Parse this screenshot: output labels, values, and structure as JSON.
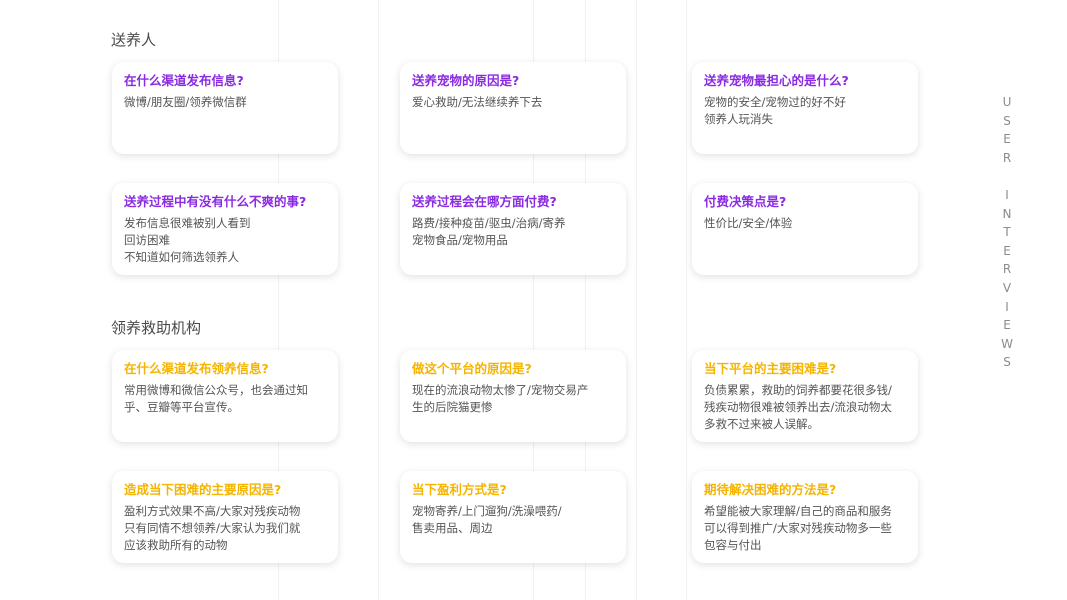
{
  "colors": {
    "purple_question": "#8a2be2",
    "yellow_question": "#f5b400",
    "side_text": "#8c8c8c"
  },
  "side_label": [
    "U",
    "S",
    "E",
    "R",
    "",
    "I",
    "N",
    "T",
    "E",
    "R",
    "V",
    "I",
    "E",
    "W",
    "S"
  ],
  "sections": [
    {
      "title": "送养人",
      "cards": [
        {
          "question": "在什么渠道发布信息?",
          "answer": "微博/朋友圈/领养微信群"
        },
        {
          "question": "送养宠物的原因是?",
          "answer": "爱心救助/无法继续养下去"
        },
        {
          "question": "送养宠物最担心的是什么?",
          "answer": "宠物的安全/宠物过的好不好\n领养人玩消失"
        },
        {
          "question": "送养过程中有没有什么不爽的事?",
          "answer": "发布信息很难被别人看到\n回访困难\n不知道如何筛选领养人"
        },
        {
          "question": "送养过程会在哪方面付费?",
          "answer": "路费/接种疫苗/驱虫/治病/寄养\n宠物食品/宠物用品"
        },
        {
          "question": "付费决策点是?",
          "answer": "性价比/安全/体验"
        }
      ]
    },
    {
      "title": "领养救助机构",
      "cards": [
        {
          "question": "在什么渠道发布领养信息?",
          "answer": "常用微博和微信公众号，也会通过知\n乎、豆瓣等平台宣传。"
        },
        {
          "question": "做这个平台的原因是?",
          "answer": "现在的流浪动物太惨了/宠物交易产\n生的后院猫更惨"
        },
        {
          "question": "当下平台的主要困难是?",
          "answer": "负债累累，救助的饲养都要花很多钱/\n残疾动物很难被领养出去/流浪动物太\n多救不过来被人误解。"
        },
        {
          "question": "造成当下困难的主要原因是?",
          "answer": "盈利方式效果不高/大家对残疾动物\n只有同情不想领养/大家认为我们就\n应该救助所有的动物"
        },
        {
          "question": "当下盈利方式是?",
          "answer": "宠物寄养/上门遛狗/洗澡喂药/\n售卖用品、周边"
        },
        {
          "question": "期待解决困难的方法是?",
          "answer": "希望能被大家理解/自己的商品和服务\n可以得到推广/大家对残疾动物多一些\n包容与付出"
        }
      ]
    }
  ]
}
